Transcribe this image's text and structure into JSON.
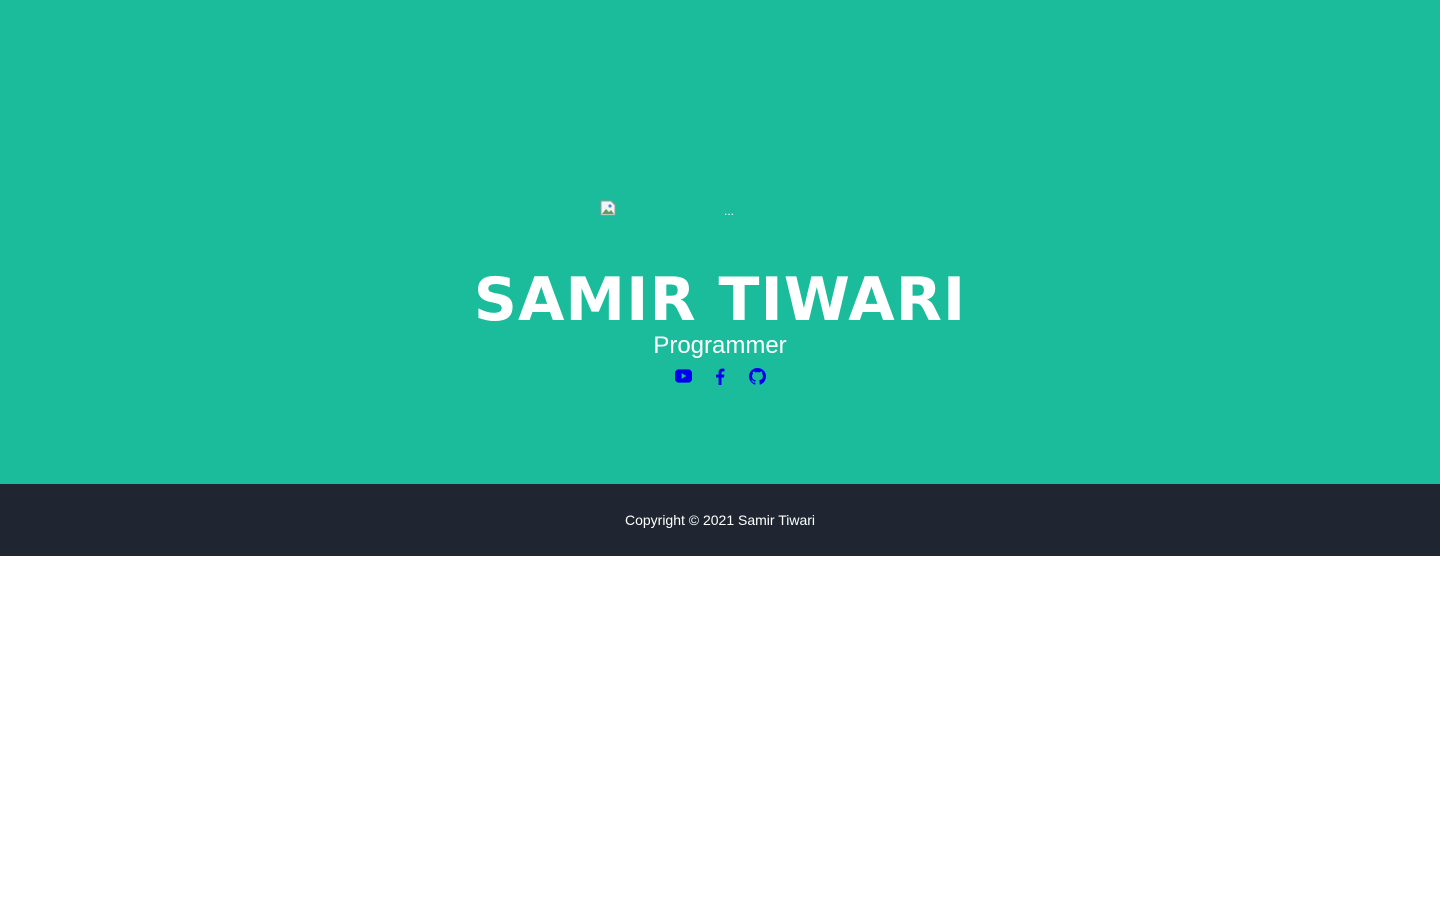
{
  "colors": {
    "masthead_bg": "#1abc9c",
    "footer_bg": "#1f2631",
    "text": "#ffffff",
    "link": "#0000ee"
  },
  "avatar": {
    "alt": "..."
  },
  "masthead": {
    "heading": "SAMIR TIWARI",
    "subheading": "Programmer"
  },
  "social": [
    {
      "icon": "youtube-icon"
    },
    {
      "icon": "facebook-icon"
    },
    {
      "icon": "github-icon"
    }
  ],
  "footer": {
    "copyright": "Copyright © 2021 Samir Tiwari"
  }
}
